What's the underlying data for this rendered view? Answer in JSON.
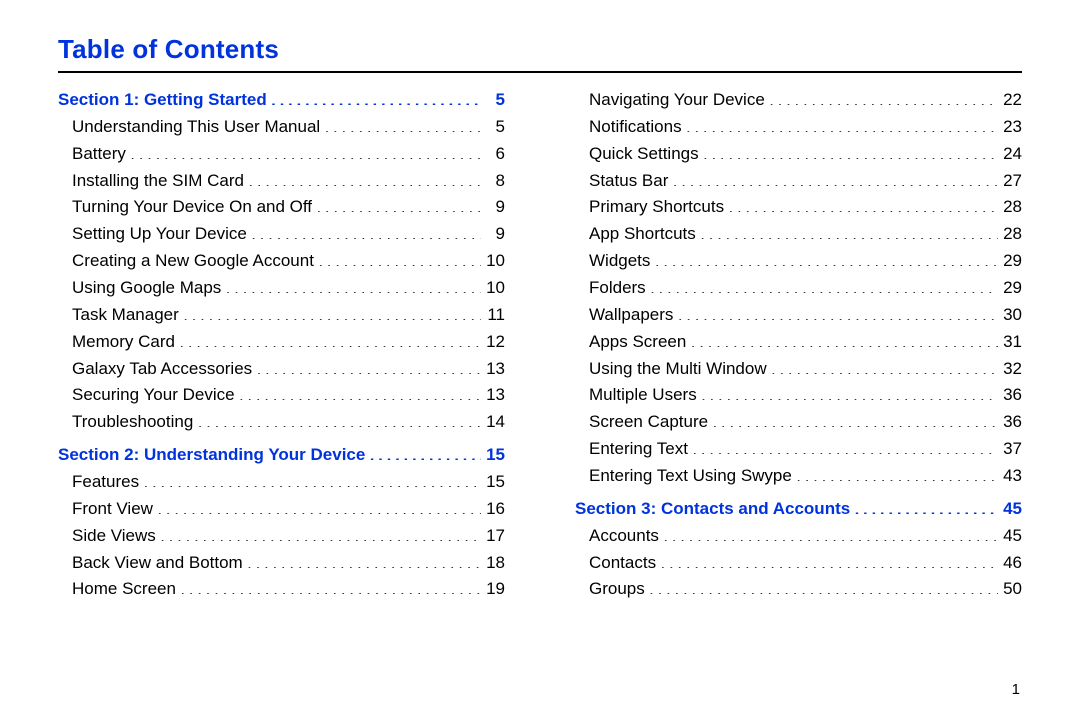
{
  "title": "Table of Contents",
  "footer_page": "1",
  "left_column": [
    {
      "type": "section",
      "label": "Section 1:  Getting Started",
      "page": "5"
    },
    {
      "type": "entry",
      "label": "Understanding This User Manual",
      "page": "5"
    },
    {
      "type": "entry",
      "label": "Battery",
      "page": "6"
    },
    {
      "type": "entry",
      "label": "Installing the SIM Card",
      "page": "8"
    },
    {
      "type": "entry",
      "label": "Turning Your Device On and Off",
      "page": "9"
    },
    {
      "type": "entry",
      "label": "Setting Up Your Device",
      "page": "9"
    },
    {
      "type": "entry",
      "label": "Creating a New Google Account",
      "page": "10"
    },
    {
      "type": "entry",
      "label": "Using Google Maps",
      "page": "10"
    },
    {
      "type": "entry",
      "label": "Task Manager",
      "page": "11"
    },
    {
      "type": "entry",
      "label": "Memory Card",
      "page": "12"
    },
    {
      "type": "entry",
      "label": "Galaxy Tab Accessories",
      "page": "13"
    },
    {
      "type": "entry",
      "label": "Securing Your Device",
      "page": "13"
    },
    {
      "type": "entry",
      "label": "Troubleshooting",
      "page": "14"
    },
    {
      "type": "section",
      "label": "Section 2:  Understanding Your Device",
      "page": "15"
    },
    {
      "type": "entry",
      "label": "Features",
      "page": "15"
    },
    {
      "type": "entry",
      "label": "Front View",
      "page": "16"
    },
    {
      "type": "entry",
      "label": "Side Views",
      "page": "17"
    },
    {
      "type": "entry",
      "label": "Back View and Bottom",
      "page": "18"
    },
    {
      "type": "entry",
      "label": "Home Screen",
      "page": "19"
    }
  ],
  "right_column": [
    {
      "type": "entry",
      "label": "Navigating Your Device",
      "page": "22"
    },
    {
      "type": "entry",
      "label": "Notifications",
      "page": "23"
    },
    {
      "type": "entry",
      "label": "Quick Settings",
      "page": "24"
    },
    {
      "type": "entry",
      "label": "Status Bar",
      "page": "27"
    },
    {
      "type": "entry",
      "label": "Primary Shortcuts",
      "page": "28"
    },
    {
      "type": "entry",
      "label": "App Shortcuts",
      "page": "28"
    },
    {
      "type": "entry",
      "label": "Widgets",
      "page": "29"
    },
    {
      "type": "entry",
      "label": "Folders",
      "page": "29"
    },
    {
      "type": "entry",
      "label": "Wallpapers",
      "page": "30"
    },
    {
      "type": "entry",
      "label": "Apps Screen",
      "page": "31"
    },
    {
      "type": "entry",
      "label": "Using the Multi Window",
      "page": "32"
    },
    {
      "type": "entry",
      "label": "Multiple Users",
      "page": "36"
    },
    {
      "type": "entry",
      "label": "Screen Capture",
      "page": "36"
    },
    {
      "type": "entry",
      "label": "Entering Text",
      "page": "37"
    },
    {
      "type": "entry",
      "label": "Entering Text Using Swype",
      "page": "43"
    },
    {
      "type": "section",
      "label": "Section 3:  Contacts and Accounts",
      "page": "45"
    },
    {
      "type": "entry",
      "label": "Accounts",
      "page": "45"
    },
    {
      "type": "entry",
      "label": "Contacts",
      "page": "46"
    },
    {
      "type": "entry",
      "label": "Groups",
      "page": "50"
    }
  ]
}
